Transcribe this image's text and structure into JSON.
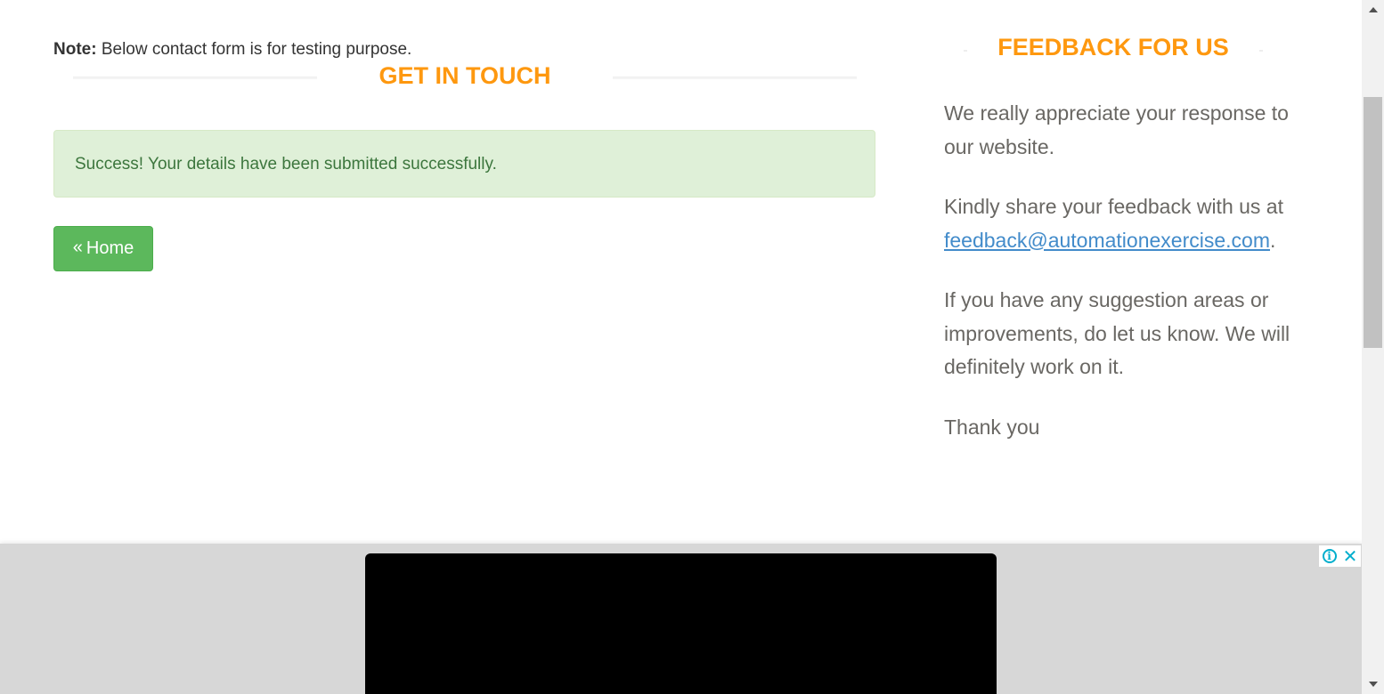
{
  "note": {
    "label": "Note:",
    "text": " Below contact form is for testing purpose."
  },
  "contact": {
    "title": "Get In Touch",
    "success_message": "Success! Your details have been submitted successfully.",
    "home_button_icon": "«",
    "home_button_label": "Home"
  },
  "feedback": {
    "title": "Feedback For Us",
    "paragraph1": "We really appreciate your response to our website.",
    "paragraph2_text": "Kindly share your feedback with us at",
    "email": "feedback@automationexercise.com",
    "paragraph2_suffix": ".",
    "paragraph3": "If you have any suggestion areas or improvements, do let us know. We will definitely work on it.",
    "paragraph4": "Thank you"
  },
  "ad": {
    "info_icon": "info-icon",
    "info_glyph": "i",
    "close_icon": "close-icon",
    "close_glyph": "✕"
  },
  "colors": {
    "accent": "#fe980f",
    "success_bg": "#dff0d8",
    "success_text": "#3c763d",
    "button_green": "#5cb85c",
    "link_blue": "#428bca",
    "ad_bg": "#d7d7d7",
    "ad_icon": "#00aecd"
  }
}
